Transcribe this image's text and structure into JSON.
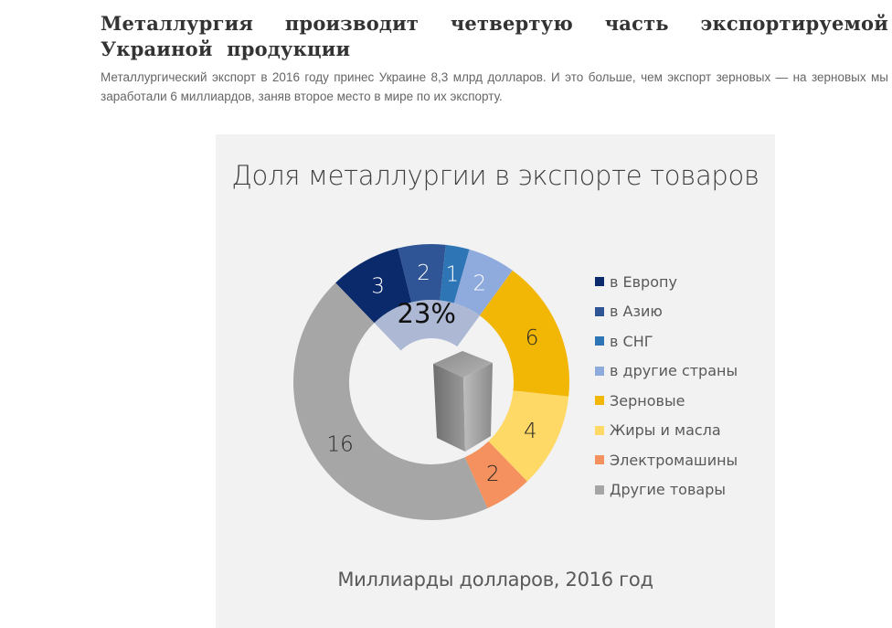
{
  "article": {
    "title": "Металлургия производит четвертую часть экспортируемой Украиной продукции",
    "lead": "Металлургический экспорт в 2016 году принес Украине 8,3 млрд долларов. И это больше, чем экспорт зерновых — на зерновых мы заработали 6 миллиардов, заняв второе место в мире по их экспорту."
  },
  "chart_data": {
    "type": "pie",
    "variant": "donut",
    "title": "Доля металлургии в экспорте товаров",
    "subtitle": "Миллиарды долларов, 2016 год",
    "unit": "млрд долларов",
    "categories": [
      "в Европу",
      "в Азию",
      "в СНГ",
      "в другие страны",
      "Зерновые",
      "Жиры и масла",
      "Электромашины",
      "Другие товары"
    ],
    "values": [
      3,
      2,
      1,
      2,
      6,
      4,
      2,
      16
    ],
    "data_labels": [
      "3",
      "2",
      "1",
      "2",
      "6",
      "4",
      "2",
      "16"
    ],
    "colors": [
      "#0b2a6b",
      "#2f5597",
      "#2e75b6",
      "#8faadc",
      "#f2b705",
      "#ffd966",
      "#f4915e",
      "#a6a6a6"
    ],
    "label_colors": [
      "#ffffff",
      "#ffffff",
      "#ffffff",
      "#ffffff",
      "#262626",
      "#262626",
      "#262626",
      "#262626"
    ],
    "highlight": {
      "label": "23%",
      "covers_categories": [
        "в Европу",
        "в Азию",
        "в СНГ",
        "в другие страны"
      ],
      "color": "#adb9d4",
      "meaning": "metallurgy share of goods export"
    },
    "center_icon": "metal-cube-icon",
    "legend": {
      "position": "right",
      "entries": [
        "в Европу",
        "в Азию",
        "в СНГ",
        "в другие страны",
        "Зерновые",
        "Жиры и масла",
        "Электромашины",
        "Другие товары"
      ]
    }
  }
}
